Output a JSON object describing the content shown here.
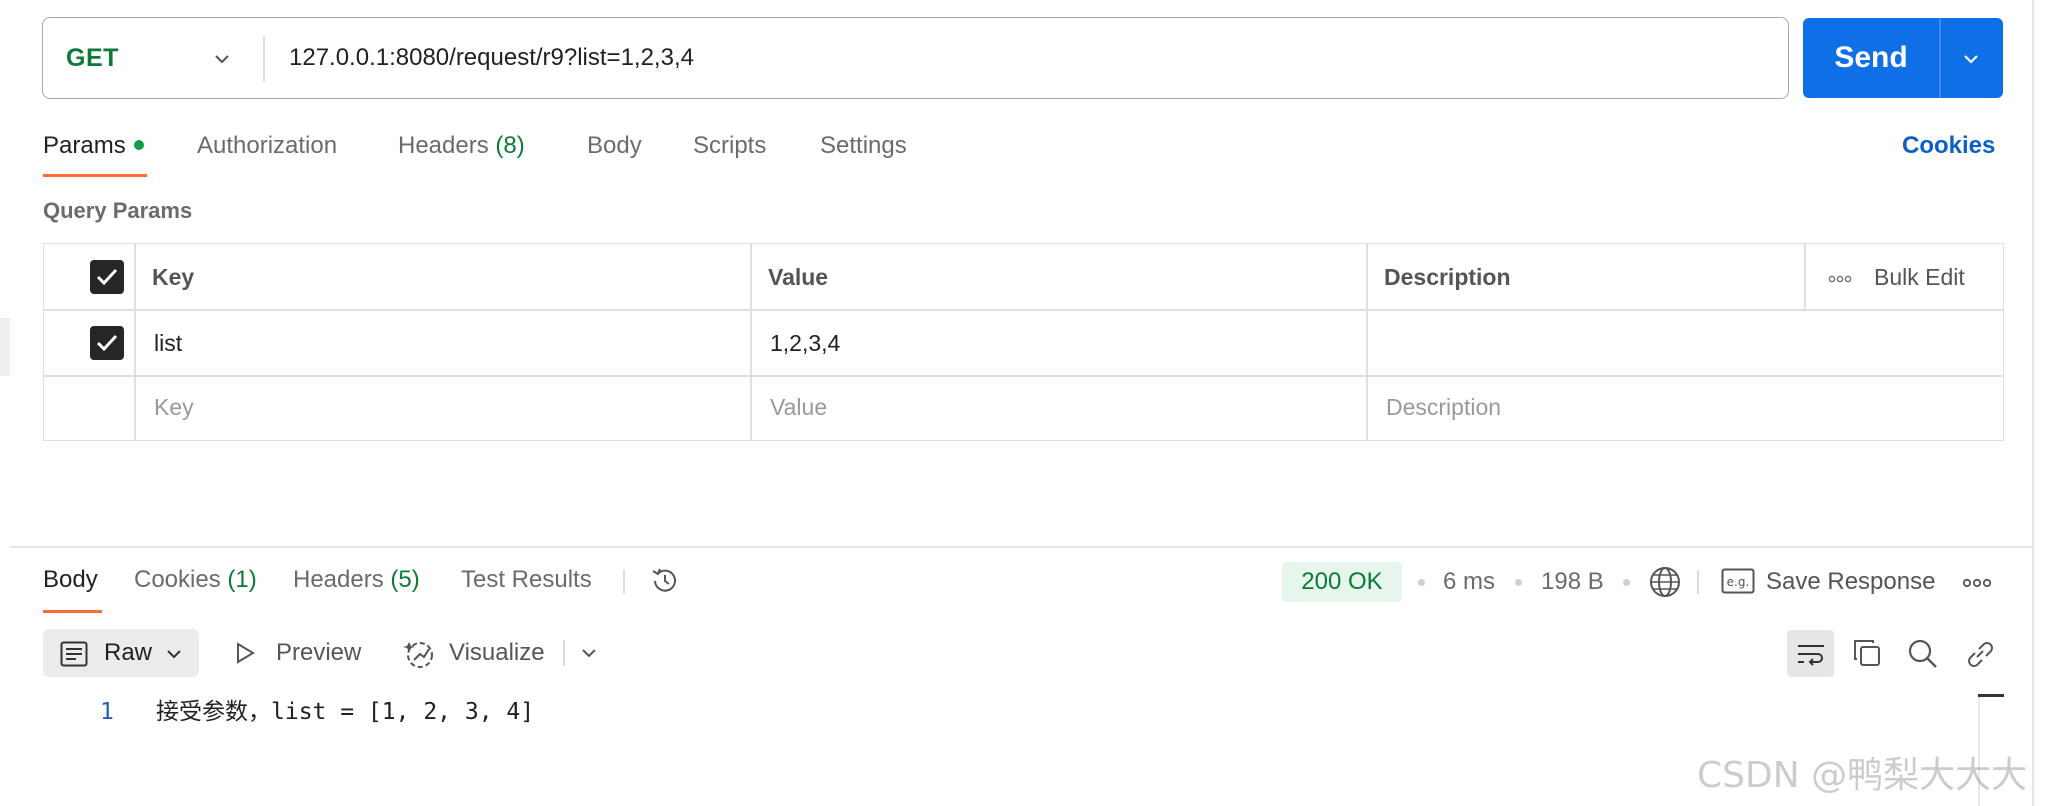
{
  "request": {
    "method": "GET",
    "url": "127.0.0.1:8080/request/r9?list=1,2,3,4",
    "send_label": "Send"
  },
  "request_tabs": {
    "params": "Params",
    "authorization": "Authorization",
    "headers": "Headers",
    "headers_count": "(8)",
    "body": "Body",
    "scripts": "Scripts",
    "settings": "Settings",
    "cookies": "Cookies"
  },
  "query_params": {
    "title": "Query Params",
    "columns": {
      "key": "Key",
      "value": "Value",
      "description": "Description"
    },
    "bulk_edit": "Bulk Edit",
    "rows": [
      {
        "checked": true,
        "key": "list",
        "value": "1,2,3,4",
        "description": ""
      }
    ],
    "placeholders": {
      "key": "Key",
      "value": "Value",
      "description": "Description"
    }
  },
  "response_tabs": {
    "body": "Body",
    "cookies": "Cookies",
    "cookies_count": "(1)",
    "headers": "Headers",
    "headers_count": "(5)",
    "test_results": "Test Results"
  },
  "response_meta": {
    "status": "200 OK",
    "time": "6 ms",
    "size": "198 B",
    "save_response": "Save Response"
  },
  "body_toolbar": {
    "raw": "Raw",
    "preview": "Preview",
    "visualize": "Visualize"
  },
  "response_body": {
    "lines": [
      {
        "number": "1",
        "text": "接受参数，list = [1, 2, 3, 4]"
      }
    ]
  },
  "watermark": "CSDN @鸭梨大大大",
  "icons": [
    "chevron-down-icon",
    "history-icon",
    "globe-icon",
    "eg-icon",
    "more-icon",
    "raw-icon",
    "play-icon",
    "visualize-icon",
    "wrap-icon",
    "copy-icon",
    "search-icon",
    "link-icon",
    "check-icon"
  ],
  "colors": {
    "accent": "#ff6c37",
    "primary": "#0f6fe6",
    "success": "#0c7a38"
  }
}
